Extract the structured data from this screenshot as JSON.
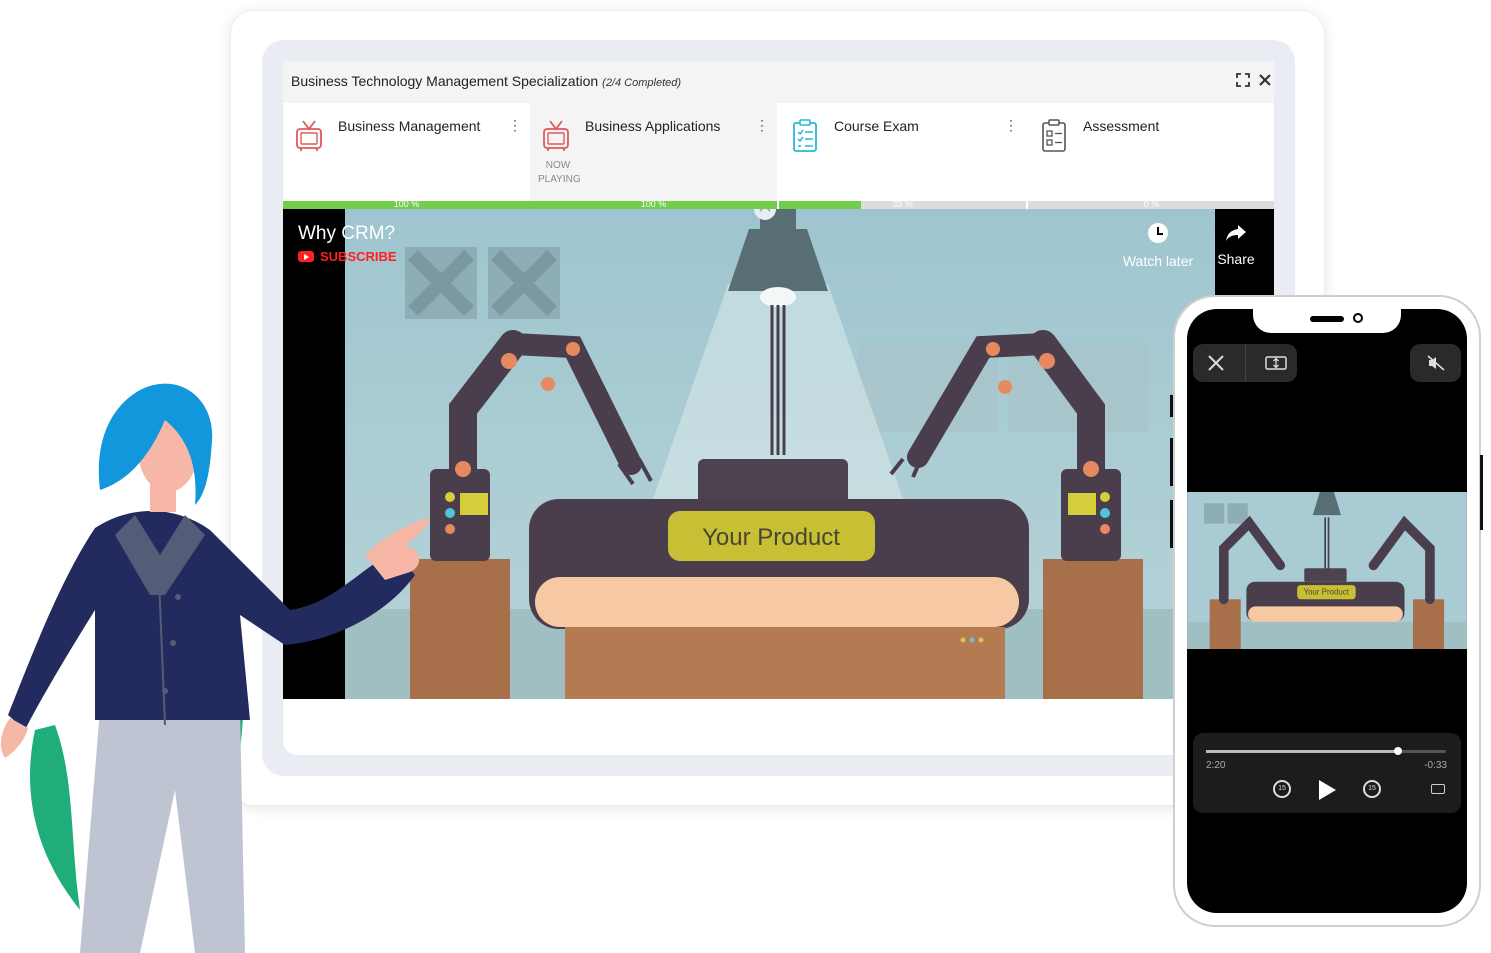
{
  "course": {
    "title": "Business Technology Management Specialization",
    "completion": "(2/4 Completed)"
  },
  "tabs": [
    {
      "label": "Business Management",
      "icon": "tv-icon",
      "progress": 100,
      "progress_label": "100 %",
      "active": false
    },
    {
      "label": "Business Applications",
      "icon": "tv-icon",
      "progress": 100,
      "progress_label": "100 %",
      "active": true,
      "status": "NOW PLAYING"
    },
    {
      "label": "Course Exam",
      "icon": "checklist-icon",
      "progress": 33,
      "progress_label": "33 %",
      "active": false
    },
    {
      "label": "Assessment",
      "icon": "clipboard-icon",
      "progress": 0,
      "progress_label": "0 %",
      "active": false
    }
  ],
  "video": {
    "title": "Why CRM?",
    "subscribe": "SUBSCRIBE",
    "watch_later": "Watch later",
    "share": "Share",
    "product_label": "Your Product"
  },
  "phone_player": {
    "elapsed": "2:20",
    "remaining": "-0:33",
    "skip_back": "15",
    "skip_forward": "15",
    "progress": 0.8
  },
  "colors": {
    "progress_fill": "#73cd4c",
    "subscribe": "#ff2020"
  }
}
